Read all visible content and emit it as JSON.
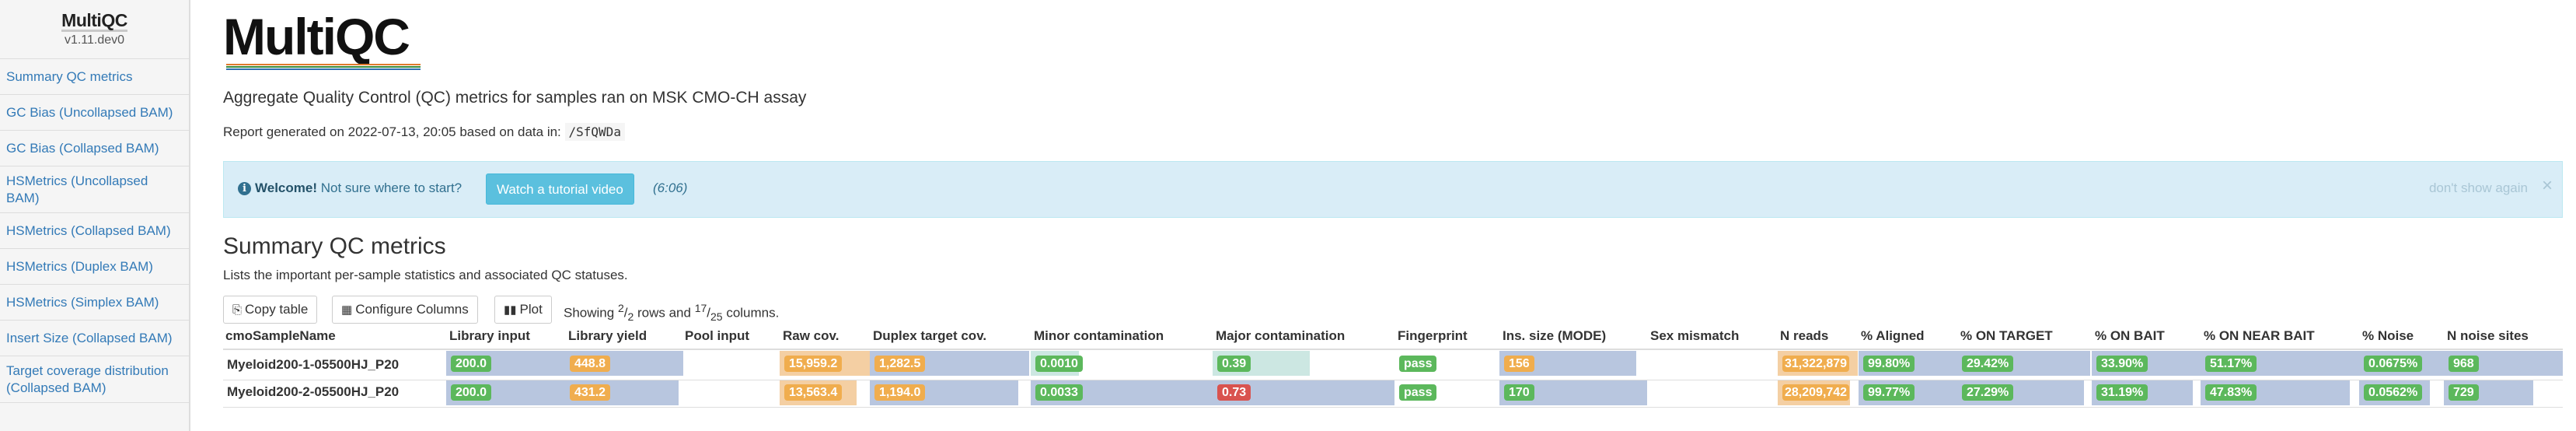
{
  "sidebar": {
    "brand": "MultiQC",
    "version": "v1.11.dev0",
    "items": [
      {
        "label": "Summary QC metrics"
      },
      {
        "label": "GC Bias (Uncollapsed BAM)"
      },
      {
        "label": "GC Bias (Collapsed BAM)"
      },
      {
        "label": "HSMetrics (Uncollapsed BAM)"
      },
      {
        "label": "HSMetrics (Collapsed BAM)"
      },
      {
        "label": "HSMetrics (Duplex BAM)"
      },
      {
        "label": "HSMetrics (Simplex BAM)"
      },
      {
        "label": "Insert Size (Collapsed BAM)"
      },
      {
        "label": "Target coverage distribution (Collapsed BAM)"
      }
    ]
  },
  "header": {
    "logo_text": "MultiQC",
    "subtitle": "Aggregate Quality Control (QC) metrics for samples ran on MSK CMO-CH assay",
    "generated_prefix": "Report generated on 2022-07-13, 20:05 based on data in: ",
    "data_path": "/SfQWDa"
  },
  "welcome": {
    "icon": "info-icon",
    "bold": "Welcome!",
    "text": " Not sure where to start?",
    "button": "Watch a tutorial video",
    "duration": "(6:06)",
    "dismiss": "don't show again",
    "close": "×"
  },
  "section": {
    "title": "Summary QC metrics",
    "description": "Lists the important per-sample statistics and associated QC statuses."
  },
  "toolbar": {
    "copy": "Copy table",
    "configure": "Configure Columns",
    "plot": "Plot",
    "showing_prefix": "Showing ",
    "rows_shown": "2",
    "rows_total": "2",
    "rows_mid": " rows and ",
    "cols_shown": "17",
    "cols_total": "25",
    "cols_suffix": " columns."
  },
  "table": {
    "headers": [
      "cmoSampleName",
      "Library input",
      "Library yield",
      "Pool input",
      "Raw cov.",
      "Duplex target cov.",
      "Minor contamination",
      "Major contamination",
      "Fingerprint",
      "Ins. size (MODE)",
      "Sex mismatch",
      "N reads",
      "% Aligned",
      "% ON TARGET",
      "% ON BAIT",
      "% ON NEAR BAIT",
      "% Noise",
      "N noise sites"
    ],
    "rows": [
      {
        "name": "Myeloid200-1-05500HJ_P20",
        "library_input": "200.0",
        "library_yield": "448.8",
        "pool_input": "",
        "raw_cov": "15,959.2",
        "duplex_cov": "1,282.5",
        "minor_contamination": "0.0010",
        "major_contamination": "0.39",
        "fingerprint": "pass",
        "ins_size": "156",
        "sex_mismatch": "",
        "n_reads": "31,322,879",
        "pct_aligned": "99.80%",
        "pct_on_target": "29.42%",
        "pct_on_bait": "33.90%",
        "pct_on_near_bait": "51.17%",
        "pct_noise": "0.0675%",
        "n_noise_sites": "968"
      },
      {
        "name": "Myeloid200-2-05500HJ_P20",
        "library_input": "200.0",
        "library_yield": "431.2",
        "pool_input": "",
        "raw_cov": "13,563.4",
        "duplex_cov": "1,194.0",
        "minor_contamination": "0.0033",
        "major_contamination": "0.73",
        "fingerprint": "pass",
        "ins_size": "170",
        "sex_mismatch": "",
        "n_reads": "28,209,742",
        "pct_aligned": "99.77%",
        "pct_on_target": "27.29%",
        "pct_on_bait": "31.19%",
        "pct_on_near_bait": "47.83%",
        "pct_noise": "0.0562%",
        "n_noise_sites": "729"
      }
    ]
  },
  "colors": {
    "link": "#337ab7",
    "pass_green": "#5cb85c",
    "warn_orange": "#f0ad4e",
    "fail_red": "#d9534f",
    "bar_blue": "#b8c6df",
    "bar_peach": "#f4cfa3",
    "bar_teal": "#cce7e2",
    "welcome_bg": "#d9edf7"
  }
}
